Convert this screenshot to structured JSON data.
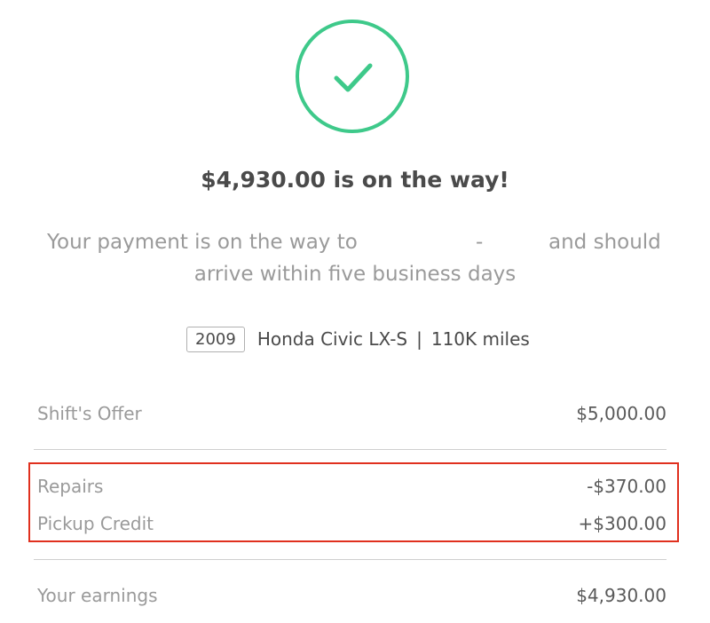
{
  "confirmation": {
    "icon": "check-icon",
    "accent_color": "#3ec98a",
    "headline": "$4,930.00 is on the way!",
    "message_part1": "Your payment is on the way to",
    "message_separator": "-",
    "message_part2": "and should",
    "message_line2": "arrive within five business days"
  },
  "vehicle": {
    "year": "2009",
    "description": "Honda Civic LX-S",
    "separator": "|",
    "mileage": "110K miles"
  },
  "breakdown": {
    "offer": {
      "label": "Shift's Offer",
      "amount": "$5,000.00"
    },
    "repairs": {
      "label": "Repairs",
      "amount": "-$370.00"
    },
    "pickup_credit": {
      "label": "Pickup Credit",
      "amount": "+$300.00"
    },
    "earnings": {
      "label": "Your earnings",
      "amount": "$4,930.00"
    },
    "highlight_color": "#e0301e"
  }
}
